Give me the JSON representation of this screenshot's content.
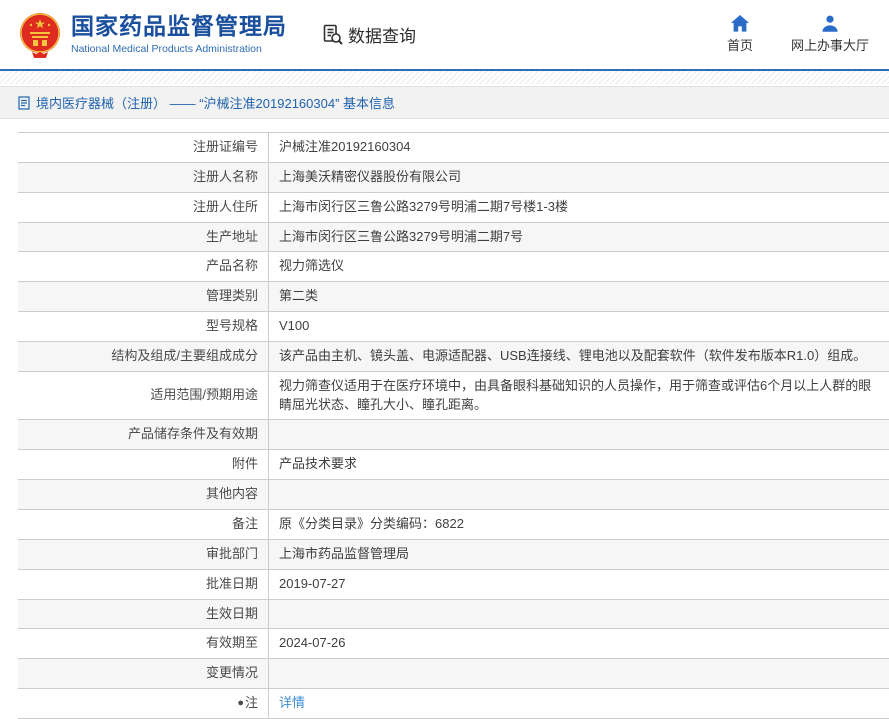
{
  "header": {
    "title": "国家药品监督管理局",
    "subtitle": "National Medical Products Administration",
    "query_label": "数据查询",
    "nav": {
      "home": "首页",
      "hall": "网上办事大厅"
    }
  },
  "breadcrumb": {
    "text": "境内医疗器械（注册） —— “沪械注准20192160304” 基本信息"
  },
  "table": {
    "note_icon_glyph": "●",
    "rows": [
      {
        "label": "注册证编号",
        "value": "沪械注准20192160304"
      },
      {
        "label": "注册人名称",
        "value": "上海美沃精密仪器股份有限公司"
      },
      {
        "label": "注册人住所",
        "value": "上海市闵行区三鲁公路3279号明浦二期7号楼1-3楼"
      },
      {
        "label": "生产地址",
        "value": "上海市闵行区三鲁公路3279号明浦二期7号"
      },
      {
        "label": "产品名称",
        "value": "视力筛选仪"
      },
      {
        "label": "管理类别",
        "value": "第二类"
      },
      {
        "label": "型号规格",
        "value": "V100"
      },
      {
        "label": "结构及组成/主要组成成分",
        "value": "该产品由主机、镜头盖、电源适配器、USB连接线、锂电池以及配套软件（软件发布版本R1.0）组成。"
      },
      {
        "label": "适用范围/预期用途",
        "value": "视力筛查仪适用于在医疗环境中，由具备眼科基础知识的人员操作，用于筛查或评估6个月以上人群的眼睛屈光状态、瞳孔大小、瞳孔距离。"
      },
      {
        "label": "产品储存条件及有效期",
        "value": ""
      },
      {
        "label": "附件",
        "value": "产品技术要求"
      },
      {
        "label": "其他内容",
        "value": ""
      },
      {
        "label": "备注",
        "value": "原《分类目录》分类编码：6822"
      },
      {
        "label": "审批部门",
        "value": "上海市药品监督管理局"
      },
      {
        "label": "批准日期",
        "value": "2019-07-27"
      },
      {
        "label": "生效日期",
        "value": ""
      },
      {
        "label": "有效期至",
        "value": "2024-07-26"
      },
      {
        "label": "变更情况",
        "value": ""
      },
      {
        "label": "注",
        "value": "详情",
        "link": true,
        "note_icon": true
      }
    ]
  },
  "colors": {
    "brand_blue": "#1a4f9e",
    "accent_blue": "#2f6db5",
    "breadcrumb_blue": "#2063ae",
    "link_blue": "#3c8cd6",
    "emblem_red": "#df2b1f",
    "emblem_gold": "#f5c33d",
    "row_alt_bg": "#f6f6f6",
    "table_border": "#cccccc"
  }
}
